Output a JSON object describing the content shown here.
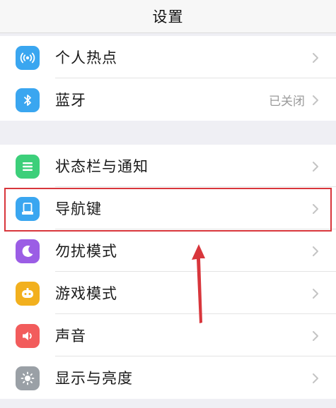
{
  "header": {
    "title": "设置"
  },
  "group1": {
    "items": [
      {
        "label": "个人热点",
        "value": "",
        "icon": "hotspot-icon",
        "color": "#3aa6f0"
      },
      {
        "label": "蓝牙",
        "value": "已关闭",
        "icon": "bluetooth-icon",
        "color": "#3aa6f0"
      }
    ]
  },
  "group2": {
    "items": [
      {
        "label": "状态栏与通知",
        "value": "",
        "icon": "notification-icon",
        "color": "#3ccf7a"
      },
      {
        "label": "导航键",
        "value": "",
        "icon": "navigation-key-icon",
        "color": "#3aa6f0"
      },
      {
        "label": "勿扰模式",
        "value": "",
        "icon": "moon-icon",
        "color": "#9b5de5"
      },
      {
        "label": "游戏模式",
        "value": "",
        "icon": "game-icon",
        "color": "#f2b01e"
      },
      {
        "label": "声音",
        "value": "",
        "icon": "speaker-icon",
        "color": "#f25c5c"
      },
      {
        "label": "显示与亮度",
        "value": "",
        "icon": "brightness-icon",
        "color": "#9aa0a6"
      }
    ]
  },
  "annotation": {
    "highlight_color": "#d8363c"
  }
}
